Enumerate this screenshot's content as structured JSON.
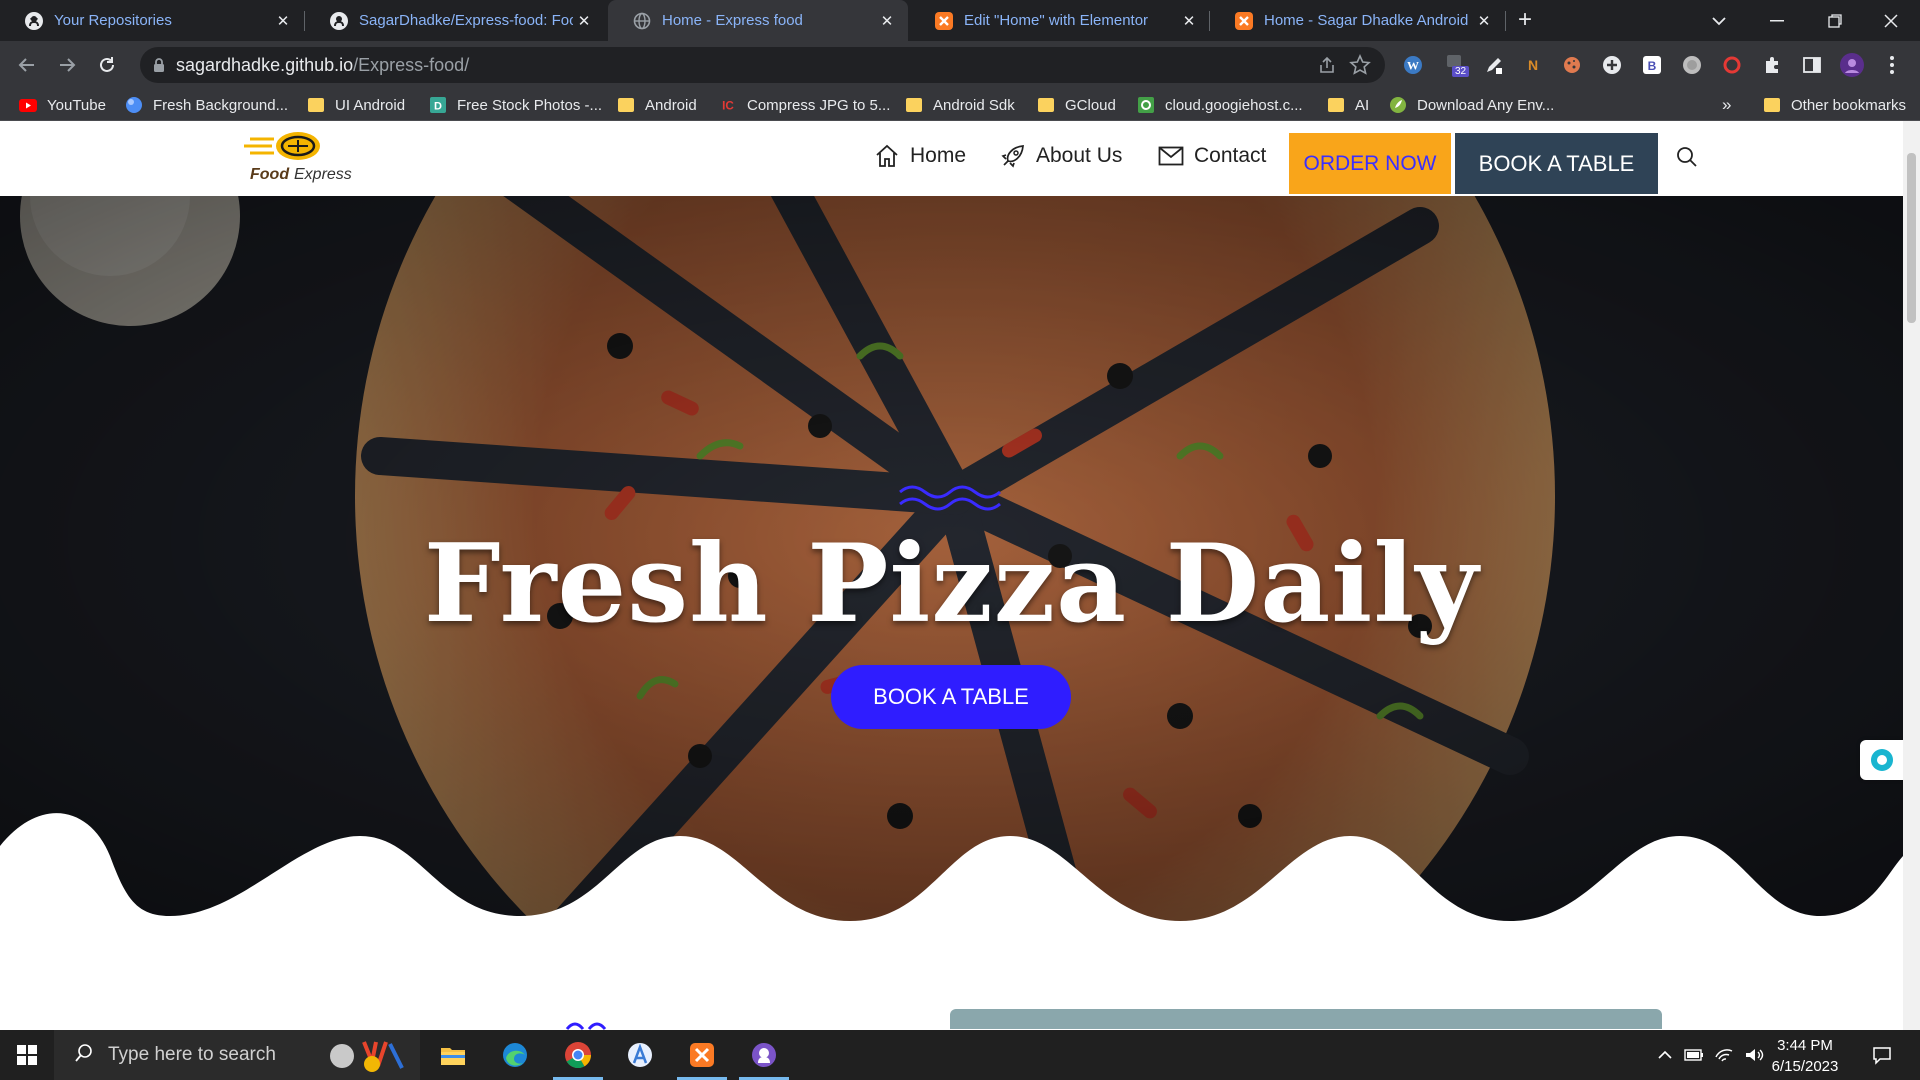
{
  "browser": {
    "tabs": [
      {
        "title": "Your Repositories",
        "icon": "github-icon"
      },
      {
        "title": "SagarDhadke/Express-food: Food",
        "icon": "github-icon"
      },
      {
        "title": "Home - Express food",
        "icon": "globe-icon",
        "active": true
      },
      {
        "title": "Edit \"Home\" with Elementor",
        "icon": "xampp-icon"
      },
      {
        "title": "Home - Sagar Dhadke Android D",
        "icon": "xampp-icon"
      }
    ],
    "url_host": "sagardhadke.github.io",
    "url_path": "/Express-food/",
    "extension_badge": "32",
    "bookmarks": [
      {
        "label": "YouTube",
        "icon": "youtube-icon"
      },
      {
        "label": "Fresh Background...",
        "icon": "circle-icon"
      },
      {
        "label": "UI Android",
        "icon": "folder-icon"
      },
      {
        "label": "Free Stock Photos -...",
        "icon": "d-icon"
      },
      {
        "label": "Android",
        "icon": "folder-icon"
      },
      {
        "label": "Compress JPG to 5...",
        "icon": "ic-icon"
      },
      {
        "label": "Android Sdk",
        "icon": "folder-icon"
      },
      {
        "label": "GCloud",
        "icon": "folder-icon"
      },
      {
        "label": "cloud.googiehost.c...",
        "icon": "googiehost-icon"
      },
      {
        "label": "AI",
        "icon": "folder-icon"
      },
      {
        "label": "Download Any Env...",
        "icon": "envato-icon"
      }
    ],
    "bookmarks_overflow": "»",
    "other_bookmarks": "Other bookmarks"
  },
  "site": {
    "logo_text_main": "Food",
    "logo_text_sub": "Express",
    "nav": {
      "home": "Home",
      "about": "About Us",
      "contact": "Contact",
      "order": "ORDER NOW",
      "book": "BOOK A TABLE"
    },
    "hero": {
      "title": "Fresh Pizza Daily",
      "cta": "BOOK A TABLE"
    },
    "colors": {
      "accent_blue": "#2f1dff",
      "order_bg": "#f9a51a",
      "book_bg": "#2f4356"
    }
  },
  "taskbar": {
    "search_placeholder": "Type here to search",
    "time": "3:44 PM",
    "date": "6/15/2023"
  }
}
